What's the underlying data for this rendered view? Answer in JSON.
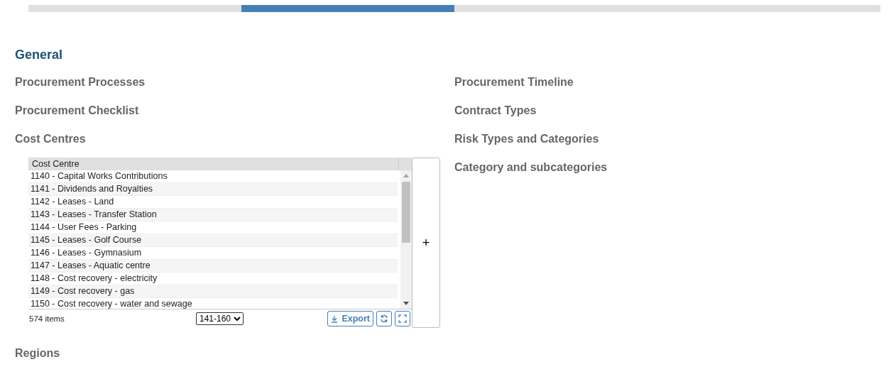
{
  "steps": [
    {
      "selected": false
    },
    {
      "selected": true
    },
    {
      "selected": false
    },
    {
      "selected": false
    }
  ],
  "title": "General",
  "left_sections": [
    "Procurement Processes",
    "Procurement Checklist",
    "Cost Centres"
  ],
  "grid": {
    "columns": [
      "Cost Centre"
    ],
    "rows": [
      "1140 - Capital Works Contributions",
      "1141 - Dividends and Royalties",
      "1142 - Leases - Land",
      "1143 - Leases - Transfer Station",
      "1144 - User Fees - Parking",
      "1145 - Leases - Golf Course",
      "1146 - Leases - Gymnasium",
      "1147 - Leases - Aquatic centre",
      "1148 - Cost recovery - electricity",
      "1149 - Cost recovery - gas",
      "1150 - Cost recovery - water and sewage"
    ],
    "item_count": "574 items",
    "page": "141-160",
    "export_label": "Export",
    "add_label": "+"
  },
  "after_sections": [
    "Regions"
  ],
  "right_sections": [
    "Procurement Timeline",
    "Contract Types",
    "Risk Types and Categories",
    "Category and subcategories"
  ]
}
